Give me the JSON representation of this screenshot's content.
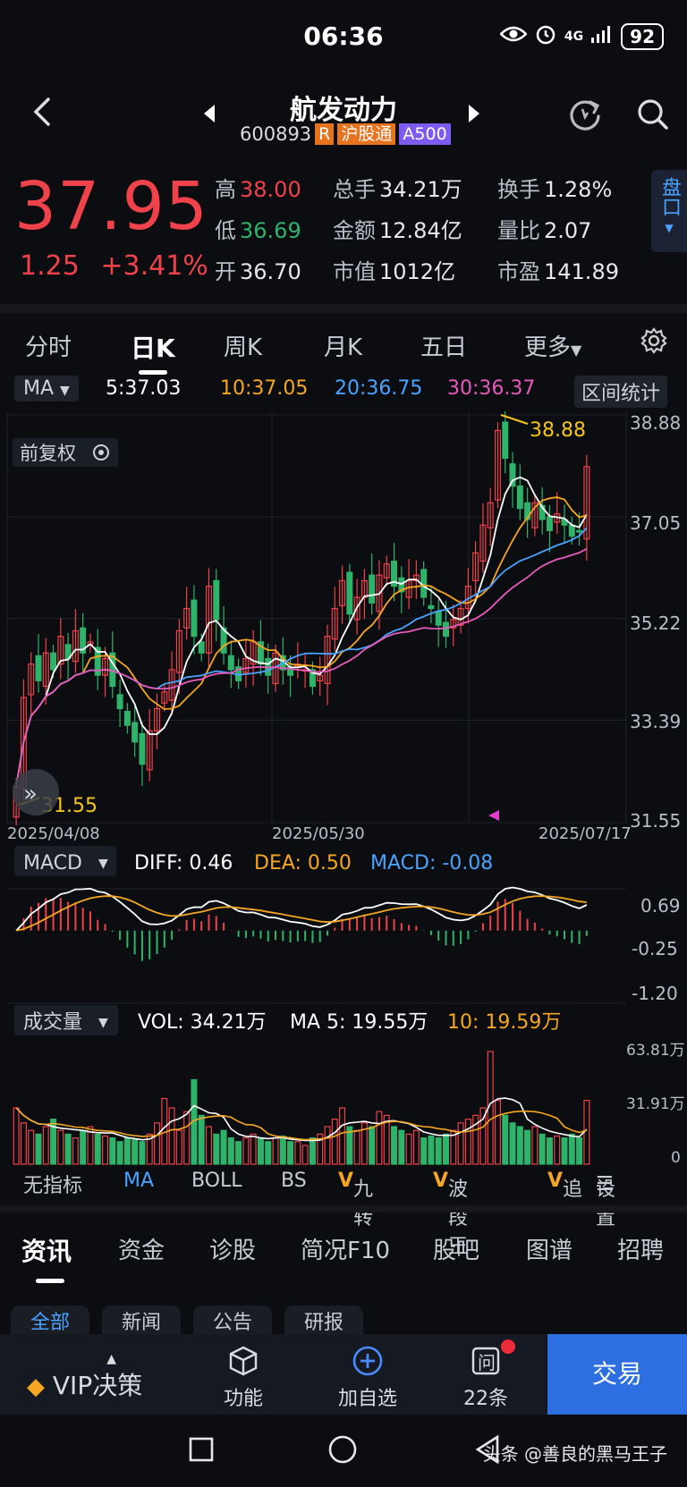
{
  "status_bar": {
    "time": "06:36",
    "network": "4G",
    "battery": "92"
  },
  "header": {
    "name": "航发动力",
    "code": "600893",
    "tags": [
      "R",
      "沪股通",
      "A500"
    ]
  },
  "quote": {
    "price": "37.95",
    "change": "1.25",
    "change_pct": "+3.41%",
    "fields": [
      {
        "label": "高",
        "value": "38.00",
        "color": "red"
      },
      {
        "label": "总手",
        "value": "34.21万",
        "color": "white"
      },
      {
        "label": "换手",
        "value": "1.28%",
        "color": "white"
      },
      {
        "label": "低",
        "value": "36.69",
        "color": "green"
      },
      {
        "label": "金额",
        "value": "12.84亿",
        "color": "white"
      },
      {
        "label": "量比",
        "value": "2.07",
        "color": "white"
      },
      {
        "label": "开",
        "value": "36.70",
        "color": "white"
      },
      {
        "label": "市值",
        "value": "1012亿",
        "color": "white"
      },
      {
        "label": "市盈",
        "value": "141.89",
        "color": "white"
      }
    ],
    "pankou": "盘口"
  },
  "chart_tabs": [
    "分时",
    "日K",
    "周K",
    "月K",
    "五日",
    "更多"
  ],
  "ma_bar": {
    "selector": "MA",
    "ma5": "5:37.03",
    "ma10": "10:37.05",
    "ma20": "20:36.75",
    "ma30": "30:36.37",
    "range_stat": "区间统计"
  },
  "kline": {
    "adjust": "前复权",
    "y_ticks": [
      "38.88",
      "37.05",
      "35.22",
      "33.39",
      "31.55"
    ],
    "x_ticks": [
      "2025/04/08",
      "2025/05/30",
      "2025/07/17"
    ],
    "high_label": "38.88",
    "low_label": "31.55"
  },
  "macd": {
    "selector": "MACD",
    "diff": "DIFF: 0.46",
    "dea": "DEA: 0.50",
    "macd": "MACD: -0.08",
    "y_ticks": [
      "0.69",
      "-0.25",
      "-1.20"
    ]
  },
  "volume": {
    "selector": "成交量",
    "vol": "VOL: 34.21万",
    "ma5": "MA 5: 19.55万",
    "ma10": "10: 19.59万",
    "y_ticks": [
      "63.81万",
      "31.91万",
      "0"
    ]
  },
  "indicators": [
    "无指标",
    "MA",
    "BOLL",
    "BS",
    "九转",
    "波段王",
    "追",
    "设置"
  ],
  "news_tabs": [
    "资讯",
    "资金",
    "诊股",
    "简况F10",
    "股吧",
    "图谱",
    "招聘"
  ],
  "news_sub_tabs": [
    "全部",
    "新闻",
    "公告",
    "研报"
  ],
  "bottom_bar": {
    "vip": "VIP决策",
    "func": "功能",
    "add": "加自选",
    "ask": "22条",
    "trade": "交易"
  },
  "watermark": "头条 @善良的黑马王子",
  "chart_data": {
    "type": "candlestick",
    "ylim": [
      31.55,
      38.88
    ],
    "x_ticks": [
      "2025/04/08",
      "2025/05/30",
      "2025/07/17"
    ],
    "high": 38.88,
    "low": 31.55,
    "closes": [
      32.2,
      33.8,
      34.4,
      34.1,
      34.6,
      34.3,
      34.9,
      34.5,
      35.0,
      34.6,
      34.8,
      34.2,
      34.5,
      34.0,
      33.6,
      33.3,
      33.0,
      32.6,
      33.2,
      33.6,
      33.9,
      34.3,
      35.0,
      35.4,
      34.9,
      34.6,
      35.8,
      35.2,
      34.6,
      34.3,
      34.1,
      34.5,
      34.8,
      34.4,
      34.2,
      34.6,
      34.3,
      34.2,
      34.4,
      34.3,
      34.0,
      34.2,
      34.9,
      35.4,
      35.9,
      35.3,
      35.6,
      35.9,
      35.5,
      36.0,
      36.2,
      35.8,
      35.7,
      35.9,
      36.0,
      35.6,
      35.4,
      35.1,
      34.9,
      35.2,
      35.4,
      35.8,
      36.4,
      36.9,
      37.3,
      38.6,
      38.1,
      37.6,
      37.2,
      37.0,
      37.3,
      37.0,
      36.8,
      37.1,
      36.9,
      36.7,
      36.8,
      37.95
    ],
    "ma_series": [
      {
        "name": "5",
        "last": 37.03
      },
      {
        "name": "10",
        "last": 37.05
      },
      {
        "name": "20",
        "last": 36.75
      },
      {
        "name": "30",
        "last": 36.37
      }
    ],
    "macd": {
      "diff": 0.46,
      "dea": 0.5,
      "macd": -0.08,
      "ylim": [
        -1.2,
        0.69
      ]
    },
    "volume": {
      "vol": "34.21万",
      "ma5": "19.55万",
      "ma10": "19.59万",
      "ylim": [
        0,
        63.81
      ],
      "values": [
        30,
        22,
        18,
        16,
        20,
        24,
        18,
        16,
        14,
        18,
        20,
        16,
        15,
        14,
        12,
        14,
        13,
        12,
        16,
        22,
        35,
        30,
        18,
        28,
        45,
        26,
        20,
        16,
        18,
        14,
        12,
        14,
        16,
        14,
        12,
        14,
        15,
        12,
        12,
        10,
        14,
        16,
        20,
        24,
        30,
        20,
        18,
        22,
        20,
        28,
        26,
        20,
        18,
        16,
        18,
        14,
        15,
        14,
        16,
        18,
        22,
        24,
        26,
        30,
        60,
        34,
        26,
        22,
        20,
        18,
        20,
        16,
        14,
        15,
        14,
        16,
        14,
        34
      ]
    }
  }
}
